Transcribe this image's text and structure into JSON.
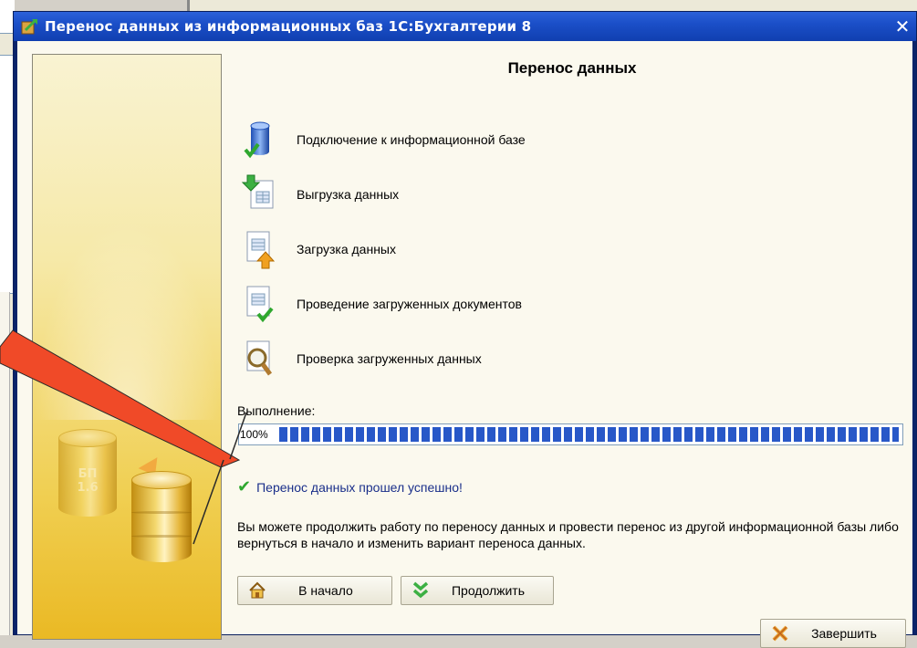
{
  "window": {
    "title": "Перенос данных из информационных баз 1С:Бухгалтерии 8",
    "close_glyph": "✕"
  },
  "side_panel": {
    "db_label_line1": "БП",
    "db_label_line2": "1.6"
  },
  "main": {
    "heading": "Перенос данных",
    "steps": [
      {
        "label": "Подключение к информационной базе",
        "icon": "database-connect-icon"
      },
      {
        "label": "Выгрузка данных",
        "icon": "data-export-icon"
      },
      {
        "label": "Загрузка данных",
        "icon": "data-import-icon"
      },
      {
        "label": "Проведение загруженных документов",
        "icon": "document-post-icon"
      },
      {
        "label": "Проверка загруженных данных",
        "icon": "data-check-icon"
      }
    ],
    "progress_label": "Выполнение:",
    "progress_text": "100%",
    "progress_value": 1.0,
    "success_message": "Перенос данных прошел успешно!",
    "info_text": "Вы можете продолжить работу по переносу данных и провести перенос из другой информационной базы либо вернуться в начало и изменить вариант переноса данных."
  },
  "buttons": {
    "home": "В начало",
    "continue": "Продолжить",
    "finish": "Завершить"
  },
  "colors": {
    "titlebar": "#1b4fc8",
    "progress_fill": "#2858c8",
    "success_text": "#1a2f8a",
    "check": "#2fa82f",
    "pointer": "#f04a28"
  }
}
